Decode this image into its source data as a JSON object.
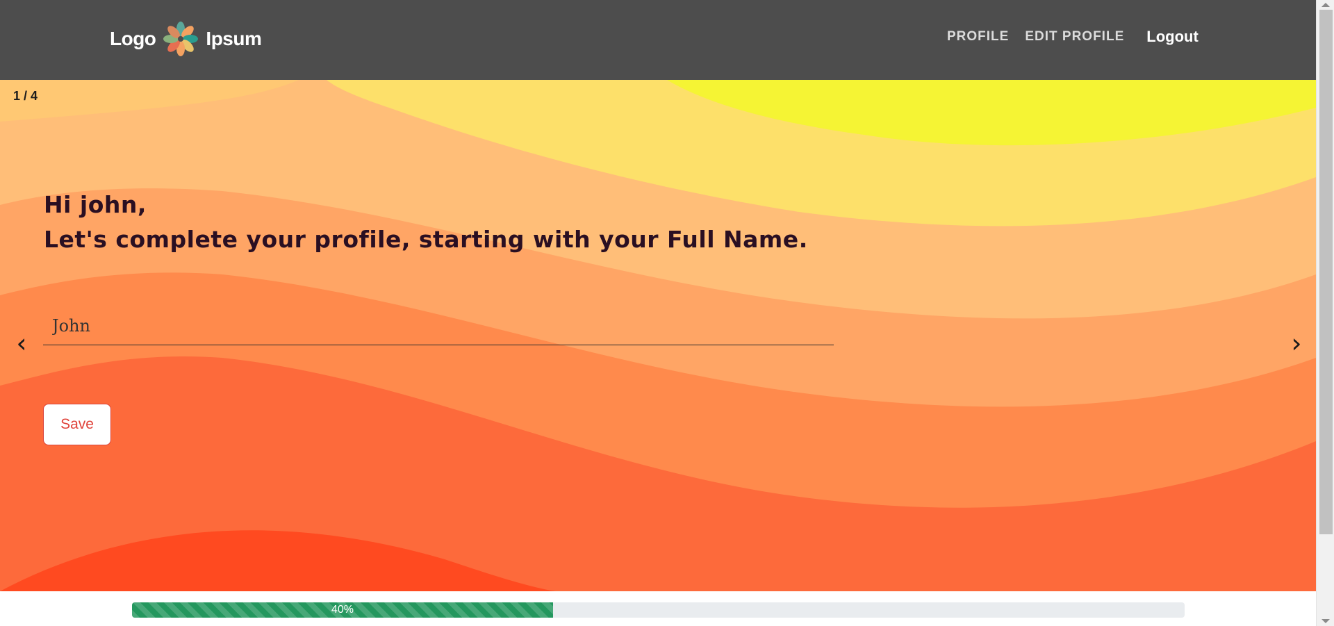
{
  "header": {
    "logo_left": "Logo",
    "logo_right": "Ipsum",
    "nav": {
      "profile": "PROFILE",
      "edit_profile": "EDIT PROFILE",
      "logout": "Logout"
    }
  },
  "slide": {
    "counter": "1 / 4",
    "greeting": "Hi john,",
    "prompt": "Let's complete your profile, starting with your Full Name.",
    "name_value": "John",
    "prev_symbol": "‹",
    "next_symbol": "›",
    "save_label": "Save"
  },
  "progress": {
    "label": "40%",
    "value": 0.4
  },
  "colors": {
    "header_bg": "#4d4d4d",
    "progress_fill": "#24975e",
    "save_text": "#e0433a",
    "headline_text": "#2a0f22"
  }
}
